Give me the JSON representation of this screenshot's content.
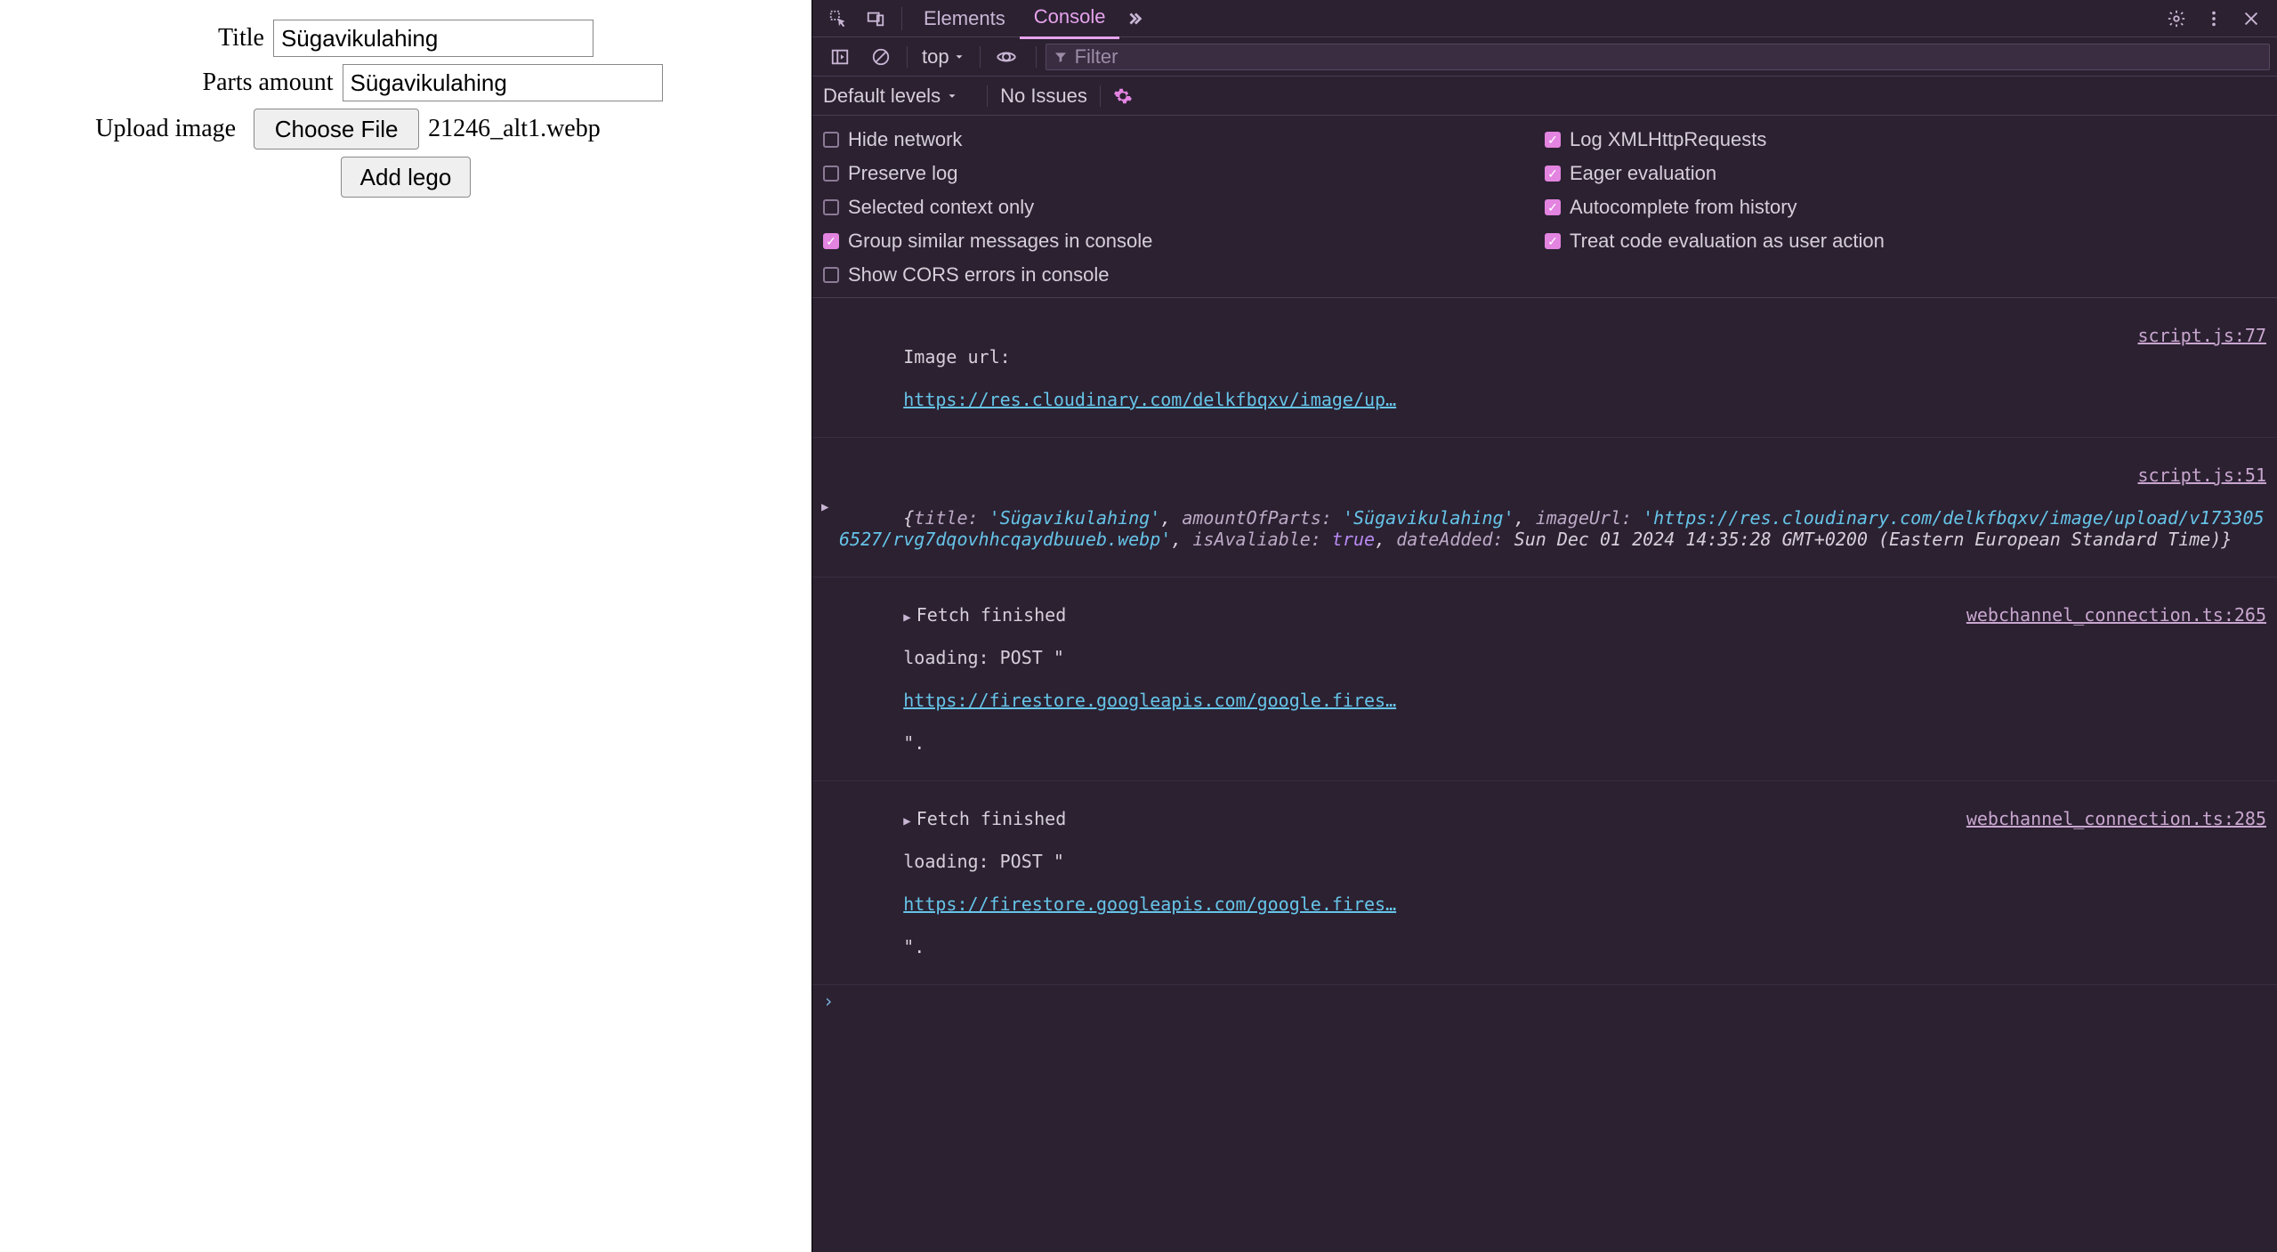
{
  "form": {
    "title_label": "Title",
    "title_value": "Sügavikulahing",
    "parts_label": "Parts amount",
    "parts_value": "Sügavikulahing",
    "upload_label": "Upload image",
    "choose_file_label": "Choose File",
    "file_name": "21246_alt1.webp",
    "submit_label": "Add lego"
  },
  "devtools": {
    "tabs": {
      "elements": "Elements",
      "console": "Console"
    },
    "console_toolbar": {
      "context": "top",
      "filter_placeholder": "Filter"
    },
    "levels_row": {
      "default_levels": "Default levels",
      "no_issues": "No Issues"
    },
    "settings": {
      "hide_network": {
        "label": "Hide network",
        "checked": false
      },
      "log_xhr": {
        "label": "Log XMLHttpRequests",
        "checked": true
      },
      "preserve_log": {
        "label": "Preserve log",
        "checked": false
      },
      "eager_eval": {
        "label": "Eager evaluation",
        "checked": true
      },
      "selected_context": {
        "label": "Selected context only",
        "checked": false
      },
      "autocomplete_hist": {
        "label": "Autocomplete from history",
        "checked": true
      },
      "group_similar": {
        "label": "Group similar messages in console",
        "checked": true
      },
      "treat_user_action": {
        "label": "Treat code evaluation as user action",
        "checked": true
      },
      "show_cors": {
        "label": "Show CORS errors in console",
        "checked": false
      }
    },
    "log": {
      "entry0": {
        "source": "script.js:77",
        "prefix": "Image url: ",
        "url": "https://res.cloudinary.com/delkfbqxv/image/up…"
      },
      "entry1": {
        "source": "script.js:51",
        "obj_open": "{",
        "k_title": "title:",
        "v_title": "'Sügavikulahing'",
        "k_amount": "amountOfParts:",
        "v_amount": "'Sügavikulahing'",
        "k_imageUrl": "imageUrl:",
        "v_imageUrl": "'https://res.cloudinary.com/delkfbqxv/image/upload/v1733056527/rvg7dqovhhcqaydbuueb.webp'",
        "k_isAvail": "isAvaliable:",
        "v_isAvail": "true",
        "k_dateAdded": "dateAdded:",
        "v_dateAdded": "Sun Dec 01 2024 14:35:28 GMT+0200 (Eastern European Standard Time)",
        "obj_close": "}"
      },
      "entry2": {
        "source": "webchannel_connection.ts:265",
        "line1a": "Fetch finished loading: POST \"",
        "url": "https://firestore.googleapis.com/google.fires…",
        "line2": "\"."
      },
      "entry3": {
        "source": "webchannel_connection.ts:285",
        "line1a": "Fetch finished loading: POST \"",
        "url": "https://firestore.googleapis.com/google.fires…",
        "line2": "\"."
      }
    }
  }
}
